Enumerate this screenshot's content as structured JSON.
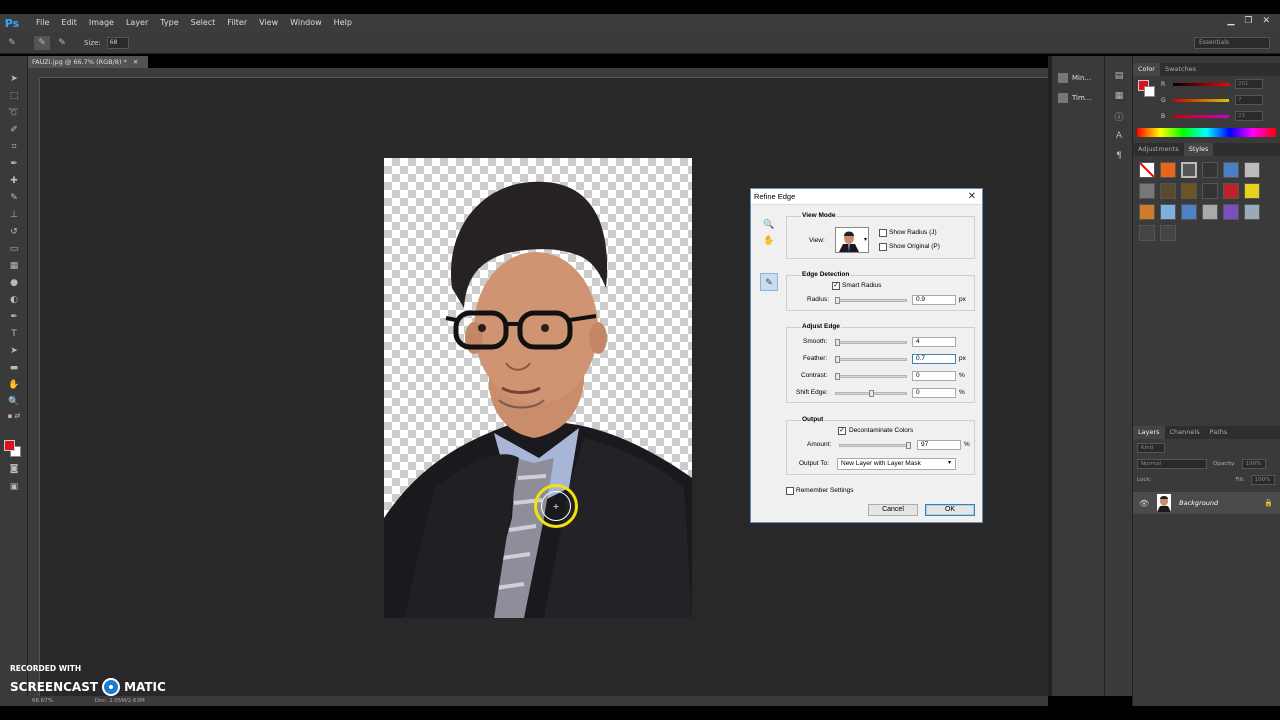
{
  "app": {
    "logo": "Ps"
  },
  "menu": [
    "File",
    "Edit",
    "Image",
    "Layer",
    "Type",
    "Select",
    "Filter",
    "View",
    "Window",
    "Help"
  ],
  "options_bar": {
    "size_label": "Size:",
    "size_value": "68",
    "workspace": "Essentials"
  },
  "document": {
    "tab_title": "FAUZI.jpg @ 66.7% (RGB/8) *"
  },
  "status": {
    "zoom": "66.67%",
    "doc_size": "Doc: 2.05M/2.63M"
  },
  "watermark": {
    "line1": "RECORDED WITH",
    "line2a": "SCREENCAST",
    "line2b": "MATIC"
  },
  "dock_mid": [
    "Min...",
    "Tim..."
  ],
  "color_panel": {
    "tabs": [
      "Color",
      "Swatches"
    ],
    "channels": [
      {
        "label": "R",
        "value": "201"
      },
      {
        "label": "G",
        "value": "7"
      },
      {
        "label": "B",
        "value": "23"
      }
    ],
    "fg_color": "#e0101a"
  },
  "styles_panel": {
    "tabs": [
      "Adjustments",
      "Styles"
    ]
  },
  "layers_panel": {
    "tabs": [
      "Layers",
      "Channels",
      "Paths"
    ],
    "kind": "Kind",
    "blend_mode": "Normal",
    "opacity_label": "Opacity:",
    "opacity_value": "100%",
    "lock_label": "Lock:",
    "fill_label": "Fill:",
    "fill_value": "100%",
    "layer_name": "Background"
  },
  "dialog": {
    "title": "Refine Edge",
    "view_mode": {
      "title": "View Mode",
      "view_label": "View:",
      "show_radius": "Show Radius (J)",
      "show_original": "Show Original (P)"
    },
    "edge_detection": {
      "title": "Edge Detection",
      "smart_radius": "Smart Radius",
      "radius_label": "Radius:",
      "radius_value": "0.9",
      "radius_unit": "px"
    },
    "adjust_edge": {
      "title": "Adjust Edge",
      "smooth_label": "Smooth:",
      "smooth_value": "4",
      "feather_label": "Feather:",
      "feather_value": "0.7",
      "feather_unit": "px",
      "contrast_label": "Contrast:",
      "contrast_value": "0",
      "contrast_unit": "%",
      "shift_label": "Shift Edge:",
      "shift_value": "0",
      "shift_unit": "%"
    },
    "output": {
      "title": "Output",
      "decontaminate": "Decontaminate Colors",
      "amount_label": "Amount:",
      "amount_value": "97",
      "amount_unit": "%",
      "output_to_label": "Output To:",
      "output_to_value": "New Layer with Layer Mask"
    },
    "remember": "Remember Settings",
    "cancel": "Cancel",
    "ok": "OK"
  }
}
